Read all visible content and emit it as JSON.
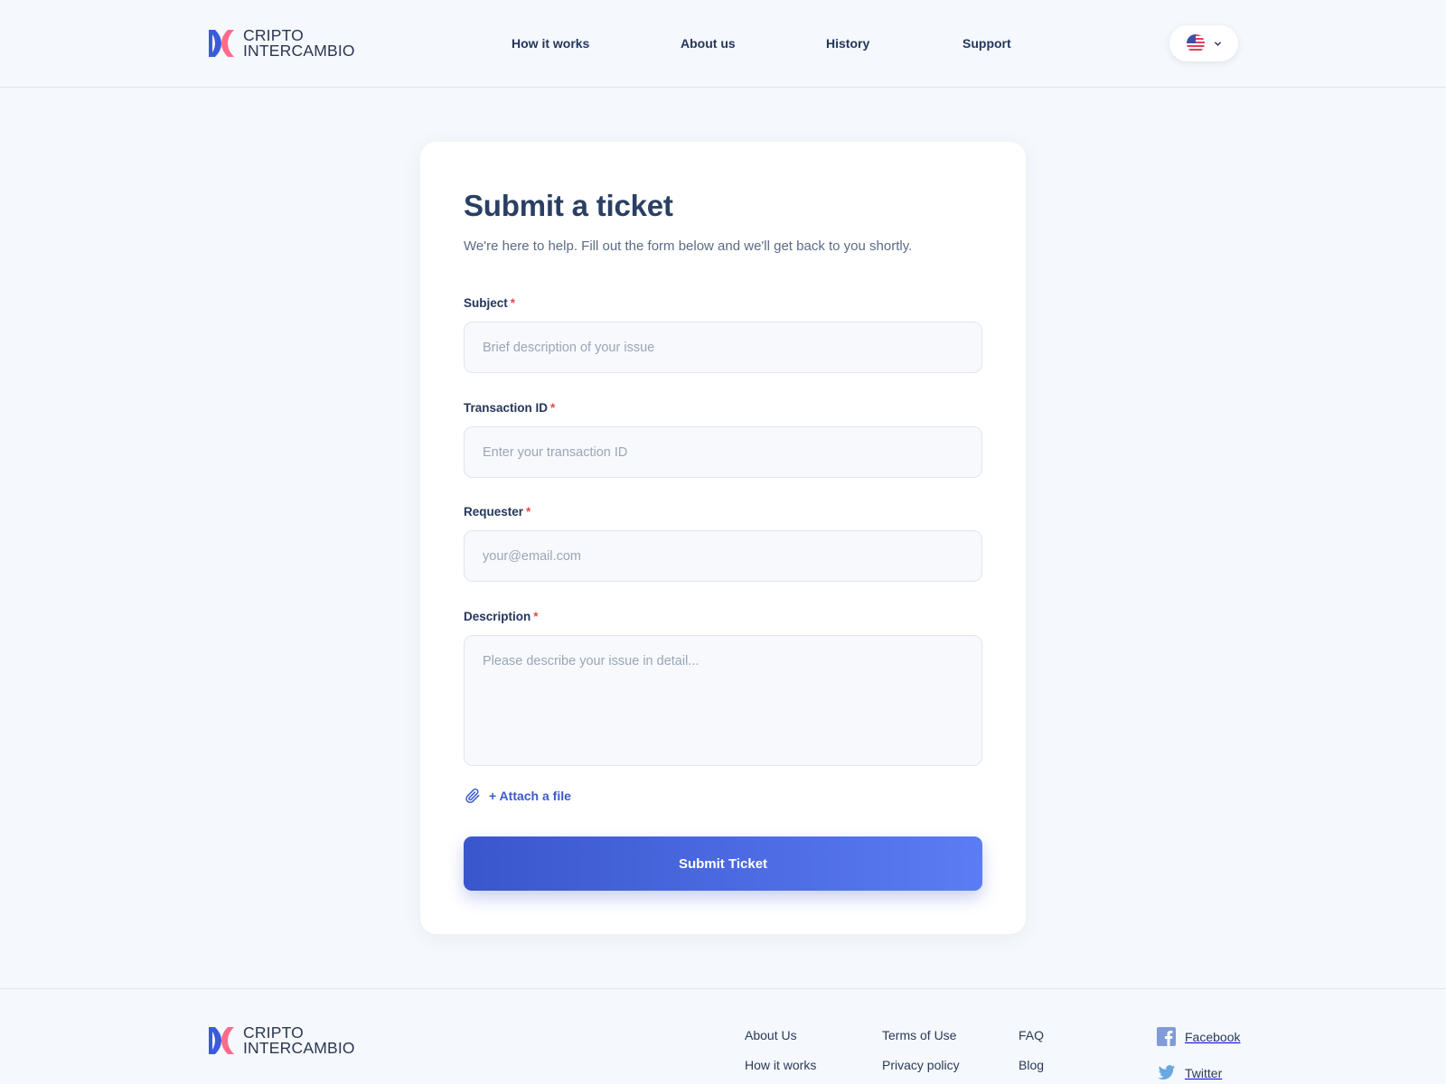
{
  "brand": {
    "line1": "CRIPTO",
    "line2": "INTERCAMBIO",
    "colors": {
      "blue": "#3b5bdb",
      "pink": "#ff6b8b"
    }
  },
  "header": {
    "nav": [
      "How it works",
      "About us",
      "History",
      "Support"
    ],
    "language": {
      "flag": "us-flag-icon",
      "selected": "English (US)"
    }
  },
  "form": {
    "title": "Submit a ticket",
    "subtitle": "We're here to help. Fill out the form below and we'll get back to you shortly.",
    "required_marker": "*",
    "fields": {
      "subject": {
        "label": "Subject",
        "placeholder": "Brief description of your issue",
        "value": ""
      },
      "transaction_id": {
        "label": "Transaction ID",
        "placeholder": "Enter your transaction ID",
        "value": ""
      },
      "requester": {
        "label": "Requester",
        "placeholder": "your@email.com",
        "value": ""
      },
      "description": {
        "label": "Description",
        "placeholder": "Please describe your issue in detail...",
        "value": ""
      }
    },
    "attach_label": "+ Attach a file",
    "submit_label": "Submit Ticket",
    "accent_color": "#3b5bcc"
  },
  "footer": {
    "col1": [
      "About Us",
      "How it works"
    ],
    "col2": [
      "Terms of Use",
      "Privacy policy"
    ],
    "col3": [
      "FAQ",
      "Blog"
    ],
    "social": [
      {
        "label": "Facebook",
        "icon": "facebook-icon"
      },
      {
        "label": "Twitter",
        "icon": "twitter-icon"
      }
    ]
  }
}
